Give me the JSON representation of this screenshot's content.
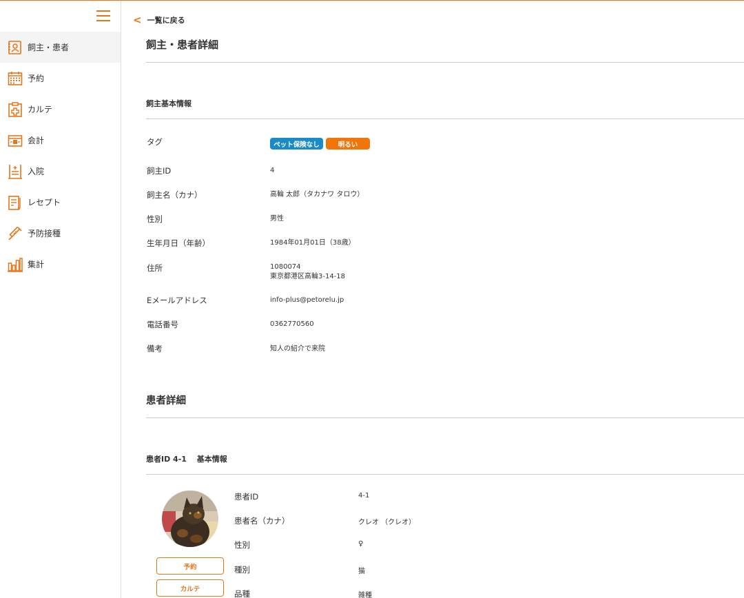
{
  "nav": {
    "items": [
      {
        "label": "飼主・患者"
      },
      {
        "label": "予約"
      },
      {
        "label": "カルテ"
      },
      {
        "label": "会計"
      },
      {
        "label": "入院"
      },
      {
        "label": "レセプト"
      },
      {
        "label": "予防接種"
      },
      {
        "label": "集計"
      }
    ]
  },
  "header": {
    "back_label": "一覧に戻る",
    "page_title": "飼主・患者詳細"
  },
  "owner": {
    "section_title": "飼主基本情報",
    "labels": {
      "tags": "タグ",
      "id": "飼主ID",
      "name": "飼主名（カナ）",
      "gender": "性別",
      "birth": "生年月日（年齢）",
      "address": "住所",
      "email": "Eメールアドレス",
      "phone": "電話番号",
      "notes": "備考"
    },
    "tags": [
      "ペット保険なし",
      "明るい"
    ],
    "id": "4",
    "name": "高輪 太郎（タカナワ タロウ）",
    "gender": "男性",
    "birth": "1984年01月01日（38歳）",
    "postal": "1080074",
    "address": "東京都港区高輪3-14-18",
    "email": "info-plus@petorelu.jp",
    "phone": "0362770560",
    "notes": "知人の紹介で来院"
  },
  "patient": {
    "heading": "患者詳細",
    "section_title": "患者ID 4-1　 基本情報",
    "reserve_button": "予約",
    "karte_button": "カルテ",
    "labels": {
      "id": "患者ID",
      "name": "患者名（カナ）",
      "gender": "性別",
      "species": "種別",
      "breed": "品種"
    },
    "id": "4-1",
    "name": "クレオ （クレオ）",
    "gender": "♀",
    "species": "猫",
    "breed": "雑種"
  },
  "colors": {
    "accent": "#e8751a",
    "tag_blue": "#1b8bc7",
    "tag_orange": "#f0760a"
  },
  "icons": [
    "menu-icon",
    "owner-patient-icon",
    "calendar-icon",
    "karte-icon",
    "accounting-icon",
    "hospitalization-icon",
    "receipt-icon",
    "vaccine-icon",
    "stats-icon",
    "back-chevron-icon"
  ]
}
